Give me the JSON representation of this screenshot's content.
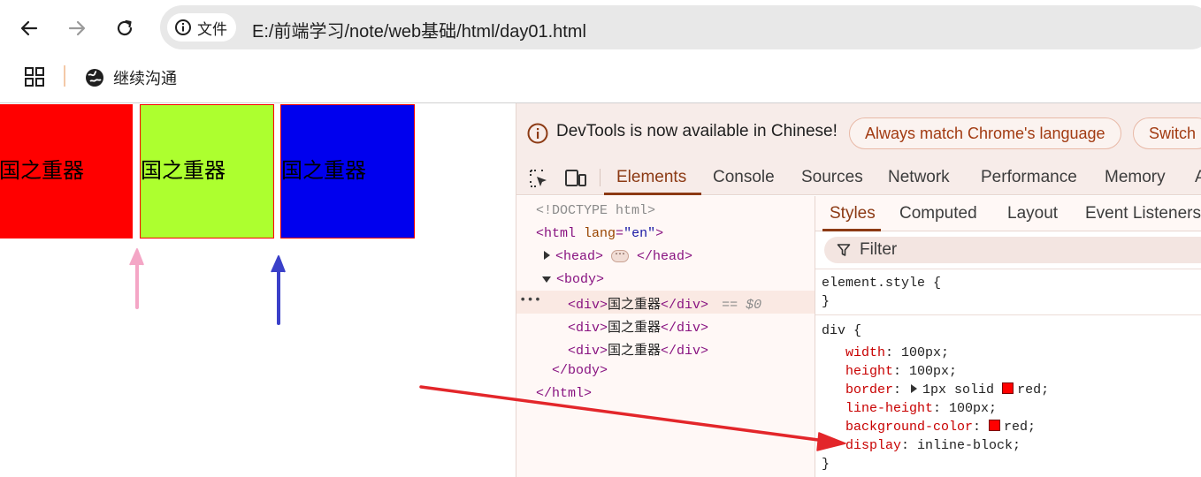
{
  "browser": {
    "back_icon": "arrow-left-icon",
    "forward_icon": "arrow-right-icon",
    "reload_icon": "reload-icon",
    "site_info_icon": "info-circle-icon",
    "site_info_label": "文件",
    "url": "E:/前端学习/note/web基础/html/day01.html",
    "bookmarks": [
      {
        "icon": "globe-icon",
        "label": "继续沟通"
      }
    ]
  },
  "page": {
    "boxes": [
      {
        "text": "国之重器",
        "color": "#ff0000"
      },
      {
        "text": "国之重器",
        "color": "#adff2f"
      },
      {
        "text": "国之重器",
        "color": "#0000ee"
      }
    ]
  },
  "devtools": {
    "infobar": {
      "message": "DevTools is now available in Chinese!",
      "match_button": "Always match Chrome's language",
      "switch_button": "Switch"
    },
    "tabs": [
      "Elements",
      "Console",
      "Sources",
      "Network",
      "Performance",
      "Memory",
      "A"
    ],
    "active_tab": "Elements",
    "elements": {
      "doctype": "<!DOCTYPE html>",
      "html_open_tag": "<html",
      "html_attr_name": "lang",
      "html_attr_value": "\"en\"",
      "html_open_end": ">",
      "head_open": "<head>",
      "head_ellipsis": "⋯",
      "head_close": "</head>",
      "body_open": "<body>",
      "div_open": "<div>",
      "div_text": "国之重器",
      "div_close": "</div>",
      "selected_marker": "== $0",
      "selection_dots": "•••",
      "body_close": "</body>",
      "html_close": "</html>"
    },
    "styles": {
      "subtabs": [
        "Styles",
        "Computed",
        "Layout",
        "Event Listeners"
      ],
      "active_subtab": "Styles",
      "filter_placeholder": "Filter",
      "element_style_selector": "element.style {",
      "close_brace": "}",
      "div_selector": "div {",
      "declarations": [
        {
          "property": "width",
          "value": "100px;"
        },
        {
          "property": "height",
          "value": "100px;"
        },
        {
          "property": "border",
          "value": "1px solid",
          "expandable": true,
          "swatch": "#ff0000",
          "color_value": "red;"
        },
        {
          "property": "line-height",
          "value": "100px;"
        },
        {
          "property": "background-color",
          "value": "",
          "swatch": "#ff0000",
          "color_value": "red;"
        },
        {
          "property": "display",
          "value": "inline-block;"
        }
      ]
    }
  },
  "annotations": {
    "colors": {
      "pink": "#f4a6c6",
      "blue": "#3a40c9",
      "red": "#e3262a"
    }
  }
}
